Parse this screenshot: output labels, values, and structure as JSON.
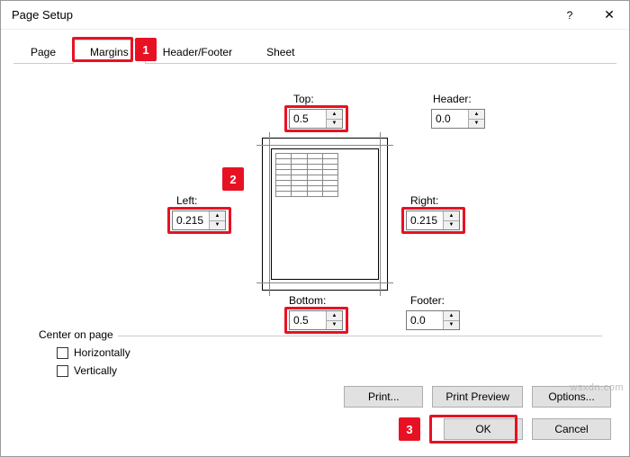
{
  "title": "Page Setup",
  "tabs": {
    "page": "Page",
    "margins": "Margins",
    "headerfooter": "Header/Footer",
    "sheet": "Sheet"
  },
  "labels": {
    "top": "Top:",
    "header": "Header:",
    "left": "Left:",
    "right": "Right:",
    "bottom": "Bottom:",
    "footer": "Footer:"
  },
  "values": {
    "top": "0.5",
    "header": "0.0",
    "left": "0.215",
    "right": "0.215",
    "bottom": "0.5",
    "footer": "0.0"
  },
  "center": {
    "legend": "Center on page",
    "horiz": "Horizontally",
    "vert": "Vertically"
  },
  "buttons": {
    "print": "Print...",
    "preview": "Print Preview",
    "options": "Options...",
    "ok": "OK",
    "cancel": "Cancel"
  },
  "callouts": {
    "c1": "1",
    "c2": "2",
    "c3": "3"
  },
  "watermark": "wsxdn.com"
}
